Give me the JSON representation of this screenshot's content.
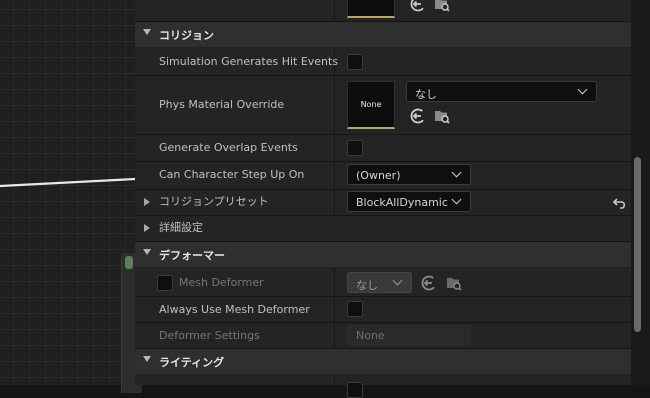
{
  "panel": {
    "categories": {
      "collision": "コリジョン",
      "deformer": "デフォーマー",
      "lighting": "ライティング"
    },
    "collision": {
      "sim_hit_events": {
        "label": "Simulation Generates Hit Events",
        "checked": false
      },
      "phys_material": {
        "label": "Phys Material Override",
        "thumb_text": "None",
        "dropdown_value": "なし"
      },
      "overlap_events": {
        "label": "Generate Overlap Events",
        "checked": false
      },
      "step_up": {
        "label": "Can Character Step Up On",
        "value": "(Owner)"
      },
      "preset": {
        "label": "コリジョンプリセット",
        "value": "BlockAllDynamic"
      },
      "advanced": {
        "label": "詳細設定"
      }
    },
    "deformer": {
      "mesh_deformer": {
        "label": "Mesh Deformer",
        "value": "なし",
        "enabled": false
      },
      "always_use": {
        "label": "Always Use Mesh Deformer",
        "checked": false
      },
      "settings": {
        "label": "Deformer Settings",
        "value": "None",
        "enabled": false
      }
    }
  },
  "icons": {
    "use_selected": "arrow-left-circle-icon",
    "browse": "folder-search-icon",
    "reset": "reset-arrow-icon"
  },
  "colors": {
    "thumb_accent": "#b7a46a",
    "node_pin": "#5e7d5a",
    "category_bg": "#2f2f2f",
    "row_bg": "#242424"
  }
}
